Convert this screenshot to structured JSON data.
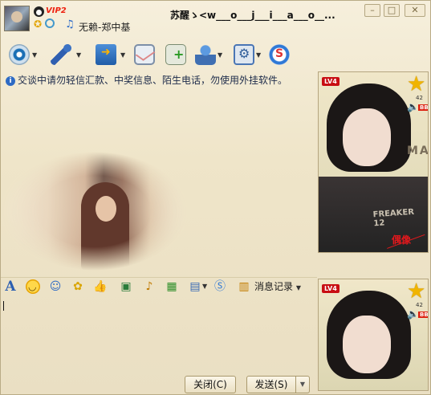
{
  "titlebar": {
    "vip_badge": "VIP2",
    "signature": "无赖-郑中基",
    "chat_title": "苏醒ゝ<w___o___j___i___a___o__..."
  },
  "window_controls": {
    "minimize": "–",
    "maximize": "□",
    "close": "✕"
  },
  "toolbar": {
    "items": [
      {
        "name": "video-chat",
        "icon": "webcam-icon"
      },
      {
        "name": "voice-chat",
        "icon": "microphone-icon"
      },
      {
        "name": "send-file",
        "icon": "folder-arrow-icon"
      },
      {
        "name": "send-email",
        "icon": "mail-icon"
      },
      {
        "name": "create-discussion",
        "icon": "add-note-icon"
      },
      {
        "name": "apps",
        "icon": "user-group-icon"
      },
      {
        "name": "settings",
        "icon": "settings-icon"
      },
      {
        "name": "soso",
        "icon": "soso-icon"
      }
    ]
  },
  "notice": {
    "text": "交谈中请勿轻信汇款、中奖信息、陌生电话，勿使用外挂软件。"
  },
  "input_toolbar": {
    "font_label": "A",
    "message_log_label": "消息记录"
  },
  "buttons": {
    "close": "关闭(C)",
    "send": "发送(S)"
  },
  "show_panel": {
    "lv_badge_top": "LV4",
    "star_count_top": "42",
    "bb_badge": "BB",
    "idol_text": "偶像",
    "shirt_text": "FREAKER 12",
    "may_text": "MAY",
    "lv_badge_bottom": "LV4",
    "star_count_bottom": "42"
  }
}
